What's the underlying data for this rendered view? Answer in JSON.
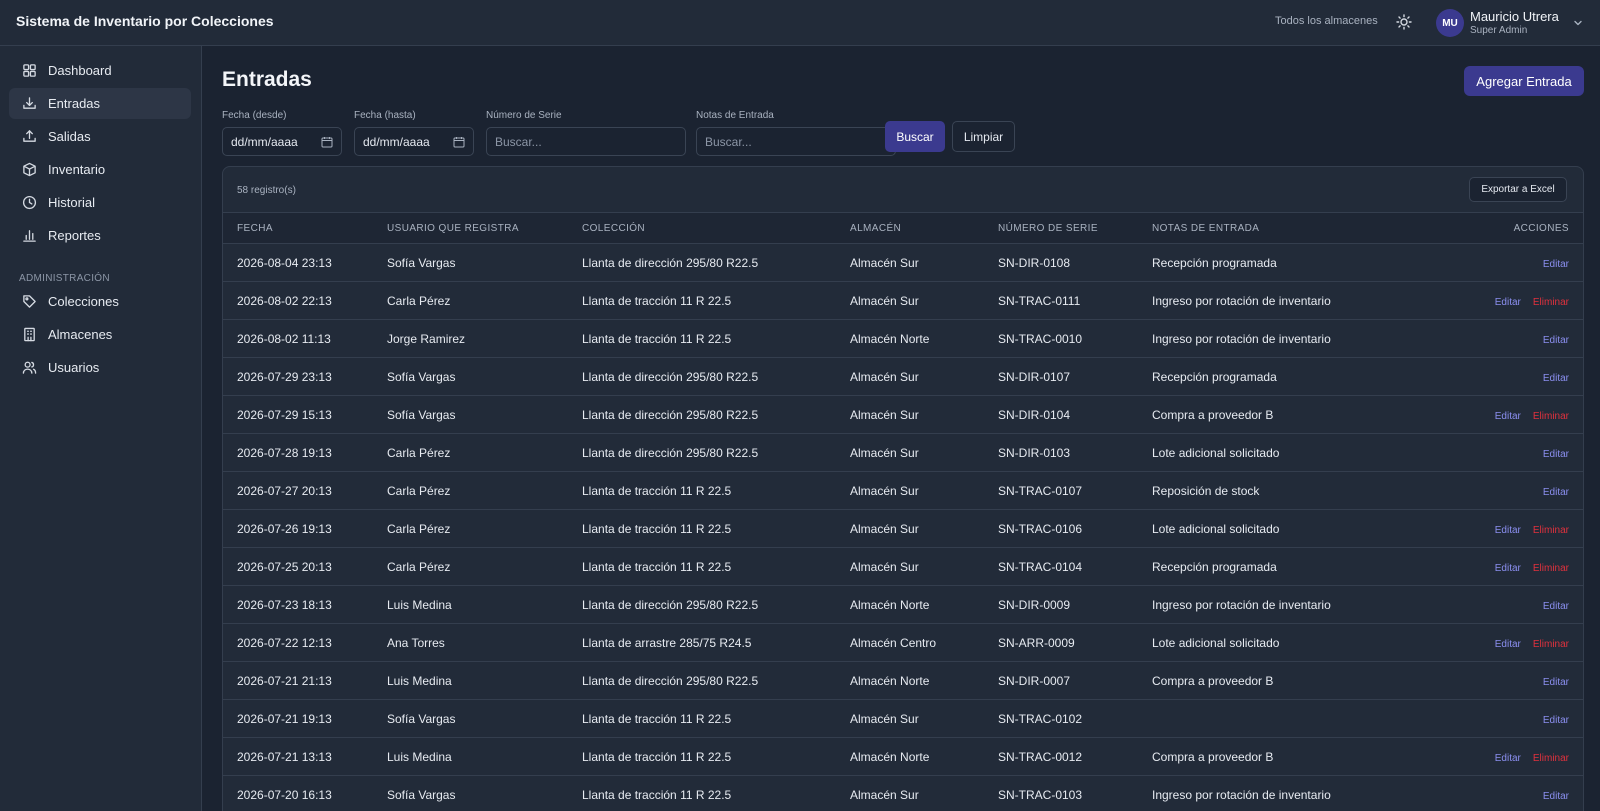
{
  "header": {
    "app_title": "Sistema de Inventario por Colecciones",
    "warehouse_scope": "Todos los almacenes",
    "theme_icon": "sun-icon",
    "user": {
      "initials": "MU",
      "name": "Mauricio Utrera",
      "role": "Super Admin"
    }
  },
  "sidebar": {
    "items": [
      {
        "label": "Dashboard",
        "icon": "grid-icon",
        "active": false
      },
      {
        "label": "Entradas",
        "icon": "download-icon",
        "active": true
      },
      {
        "label": "Salidas",
        "icon": "upload-icon",
        "active": false
      },
      {
        "label": "Inventario",
        "icon": "box-icon",
        "active": false
      },
      {
        "label": "Historial",
        "icon": "clock-icon",
        "active": false
      },
      {
        "label": "Reportes",
        "icon": "bar-chart-icon",
        "active": false
      }
    ],
    "admin_label": "ADMINISTRACIÓN",
    "admin_items": [
      {
        "label": "Colecciones",
        "icon": "tag-icon"
      },
      {
        "label": "Almacenes",
        "icon": "building-icon"
      },
      {
        "label": "Usuarios",
        "icon": "users-icon"
      }
    ]
  },
  "main": {
    "title": "Entradas",
    "add_label": "Agregar Entrada",
    "filters": {
      "date_from_label": "Fecha (desde)",
      "date_from_value": "dd/mm/aaaa",
      "date_to_label": "Fecha (hasta)",
      "date_to_value": "dd/mm/aaaa",
      "serial_label": "Número de Serie",
      "serial_placeholder": "Buscar...",
      "notes_label": "Notas de Entrada",
      "notes_placeholder": "Buscar...",
      "search_label": "Buscar",
      "clear_label": "Limpiar"
    },
    "record_count": "58 registro(s)",
    "export_label": "Exportar a Excel",
    "columns": [
      "FECHA",
      "USUARIO QUE REGISTRA",
      "COLECCIÓN",
      "ALMACÉN",
      "NÚMERO DE SERIE",
      "NOTAS DE ENTRADA",
      "ACCIONES"
    ],
    "edit_label": "Editar",
    "delete_label": "Eliminar",
    "rows": [
      {
        "fecha": "2026-08-04 23:13",
        "usuario": "Sofía Vargas",
        "coleccion": "Llanta de dirección 295/80 R22.5",
        "almacen": "Almacén Sur",
        "serie": "SN-DIR-0108",
        "notas": "Recepción programada",
        "can_delete": false
      },
      {
        "fecha": "2026-08-02 22:13",
        "usuario": "Carla Pérez",
        "coleccion": "Llanta de tracción 11 R 22.5",
        "almacen": "Almacén Sur",
        "serie": "SN-TRAC-0111",
        "notas": "Ingreso por rotación de inventario",
        "can_delete": true
      },
      {
        "fecha": "2026-08-02 11:13",
        "usuario": "Jorge Ramirez",
        "coleccion": "Llanta de tracción 11 R 22.5",
        "almacen": "Almacén Norte",
        "serie": "SN-TRAC-0010",
        "notas": "Ingreso por rotación de inventario",
        "can_delete": false
      },
      {
        "fecha": "2026-07-29 23:13",
        "usuario": "Sofía Vargas",
        "coleccion": "Llanta de dirección 295/80 R22.5",
        "almacen": "Almacén Sur",
        "serie": "SN-DIR-0107",
        "notas": "Recepción programada",
        "can_delete": false
      },
      {
        "fecha": "2026-07-29 15:13",
        "usuario": "Sofía Vargas",
        "coleccion": "Llanta de dirección 295/80 R22.5",
        "almacen": "Almacén Sur",
        "serie": "SN-DIR-0104",
        "notas": "Compra a proveedor B",
        "can_delete": true
      },
      {
        "fecha": "2026-07-28 19:13",
        "usuario": "Carla Pérez",
        "coleccion": "Llanta de dirección 295/80 R22.5",
        "almacen": "Almacén Sur",
        "serie": "SN-DIR-0103",
        "notas": "Lote adicional solicitado",
        "can_delete": false
      },
      {
        "fecha": "2026-07-27 20:13",
        "usuario": "Carla Pérez",
        "coleccion": "Llanta de tracción 11 R 22.5",
        "almacen": "Almacén Sur",
        "serie": "SN-TRAC-0107",
        "notas": "Reposición de stock",
        "can_delete": false
      },
      {
        "fecha": "2026-07-26 19:13",
        "usuario": "Carla Pérez",
        "coleccion": "Llanta de tracción 11 R 22.5",
        "almacen": "Almacén Sur",
        "serie": "SN-TRAC-0106",
        "notas": "Lote adicional solicitado",
        "can_delete": true
      },
      {
        "fecha": "2026-07-25 20:13",
        "usuario": "Carla Pérez",
        "coleccion": "Llanta de tracción 11 R 22.5",
        "almacen": "Almacén Sur",
        "serie": "SN-TRAC-0104",
        "notas": "Recepción programada",
        "can_delete": true
      },
      {
        "fecha": "2026-07-23 18:13",
        "usuario": "Luis Medina",
        "coleccion": "Llanta de dirección 295/80 R22.5",
        "almacen": "Almacén Norte",
        "serie": "SN-DIR-0009",
        "notas": "Ingreso por rotación de inventario",
        "can_delete": false
      },
      {
        "fecha": "2026-07-22 12:13",
        "usuario": "Ana Torres",
        "coleccion": "Llanta de arrastre 285/75 R24.5",
        "almacen": "Almacén Centro",
        "serie": "SN-ARR-0009",
        "notas": "Lote adicional solicitado",
        "can_delete": true
      },
      {
        "fecha": "2026-07-21 21:13",
        "usuario": "Luis Medina",
        "coleccion": "Llanta de dirección 295/80 R22.5",
        "almacen": "Almacén Norte",
        "serie": "SN-DIR-0007",
        "notas": "Compra a proveedor B",
        "can_delete": false
      },
      {
        "fecha": "2026-07-21 19:13",
        "usuario": "Sofía Vargas",
        "coleccion": "Llanta de tracción 11 R 22.5",
        "almacen": "Almacén Sur",
        "serie": "SN-TRAC-0102",
        "notas": "",
        "can_delete": false
      },
      {
        "fecha": "2026-07-21 13:13",
        "usuario": "Luis Medina",
        "coleccion": "Llanta de tracción 11 R 22.5",
        "almacen": "Almacén Norte",
        "serie": "SN-TRAC-0012",
        "notas": "Compra a proveedor B",
        "can_delete": true
      },
      {
        "fecha": "2026-07-20 16:13",
        "usuario": "Sofía Vargas",
        "coleccion": "Llanta de tracción 11 R 22.5",
        "almacen": "Almacén Sur",
        "serie": "SN-TRAC-0103",
        "notas": "Ingreso por rotación de inventario",
        "can_delete": false
      }
    ]
  }
}
